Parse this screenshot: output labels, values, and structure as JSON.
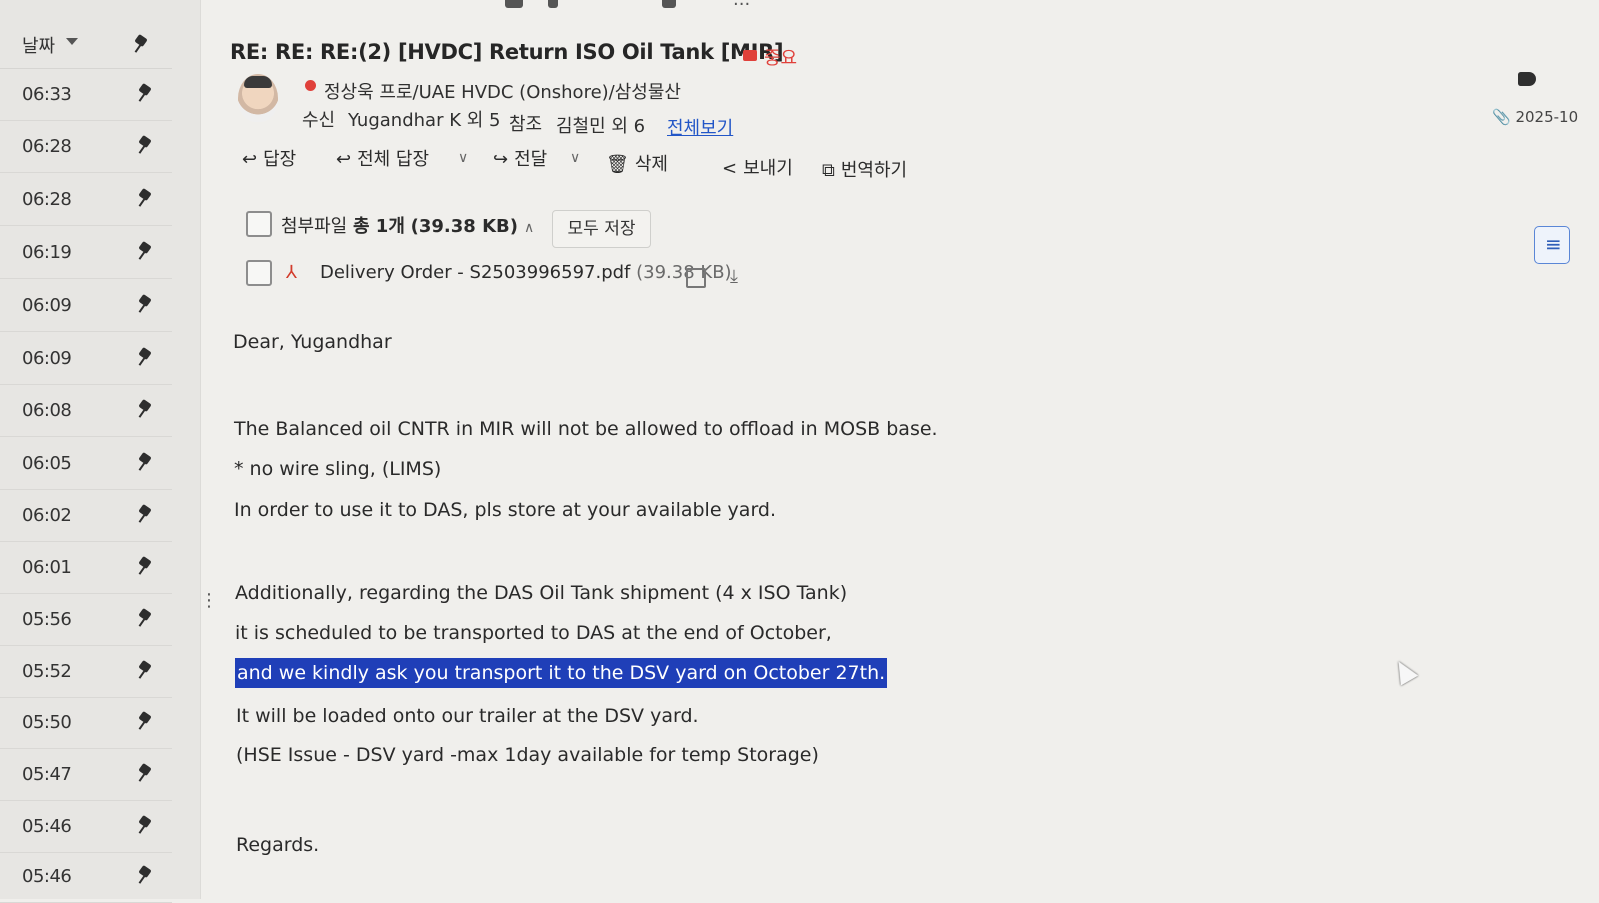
{
  "list": {
    "sort_label": "날짜",
    "times": [
      "06:33",
      "06:28",
      "06:28",
      "06:19",
      "06:09",
      "06:09",
      "06:08",
      "06:05",
      "06:02",
      "06:01",
      "05:56",
      "05:52",
      "05:50",
      "05:47",
      "05:46",
      "05:46"
    ]
  },
  "message": {
    "subject": "RE: RE: RE:(2) [HVDC] Return ISO Oil Tank [MIR]",
    "importance": "중요",
    "sender": "정상욱 프로/UAE HVDC (Onshore)/삼성물산",
    "recipients_label": "수신",
    "recipients": "Yugandhar K 외 5",
    "cc_label": "참조",
    "cc": "김철민 외 6",
    "view_all": "전체보기",
    "date": "2025-10"
  },
  "actions": {
    "reply": "답장",
    "reply_all": "전체 답장",
    "forward": "전달",
    "delete": "삭제",
    "share": "보내기",
    "translate": "번역하기"
  },
  "attachments": {
    "label": "첨부파일",
    "count": "총 1개",
    "total_size": "(39.38 KB)",
    "save_all": "모두 저장",
    "files": [
      {
        "name": "Delivery Order - S2503996597.pdf",
        "size": "(39.38 KB)"
      }
    ]
  },
  "body": {
    "greeting": "Dear, Yugandhar",
    "p1": "The Balanced oil CNTR in MIR will not be allowed to offload in MOSB base.",
    "p2": "* no wire sling, (LIMS)",
    "p3": "In order to use it to DAS, pls store at your available yard.",
    "p4": "Additionally, regarding the DAS Oil Tank shipment (4 x ISO Tank)",
    "p5": "it is scheduled to be transported to DAS at the end of October,",
    "p6": "and we kindly ask you transport it to the DSV yard on October 27th.",
    "p7": "It will be loaded onto our trailer at the DSV yard.",
    "p8": "(HSE Issue - DSV yard -max 1day available for temp Storage)",
    "closing": "Regards."
  },
  "colors": {
    "highlight": "#1f3fb8",
    "importance": "#e0403a",
    "link": "#2256c7"
  }
}
